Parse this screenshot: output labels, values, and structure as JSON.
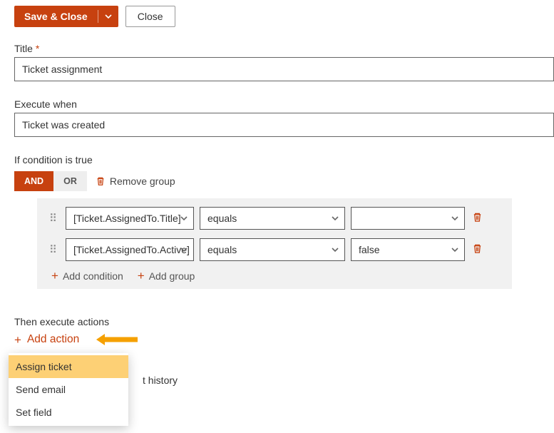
{
  "toolbar": {
    "save_close": "Save & Close",
    "close": "Close"
  },
  "fields": {
    "title_label": "Title",
    "title_value": "Ticket assignment",
    "execute_when_label": "Execute when",
    "execute_when_value": "Ticket was created"
  },
  "conditions": {
    "heading": "If condition is true",
    "logic_and": "AND",
    "logic_or": "OR",
    "remove_group": "Remove group",
    "rows": [
      {
        "field": "[Ticket.AssignedTo.Title]",
        "op": "equals",
        "value": ""
      },
      {
        "field": "[Ticket.AssignedTo.Active]",
        "op": "equals",
        "value": "false"
      }
    ],
    "add_condition": "Add condition",
    "add_group": "Add group"
  },
  "actions": {
    "heading": "Then execute actions",
    "add_action": "Add action",
    "behind_text": "t history",
    "menu": [
      "Assign ticket",
      "Send email",
      "Set field"
    ]
  },
  "colors": {
    "accent": "#c7410f"
  }
}
